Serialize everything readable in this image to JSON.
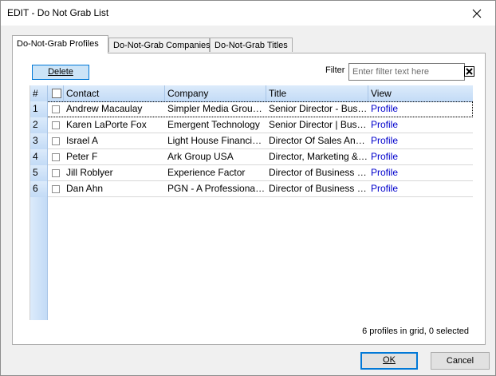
{
  "window": {
    "title": "EDIT - Do Not Grab List"
  },
  "tabs": [
    {
      "label": "Do-Not-Grab Profiles",
      "active": true
    },
    {
      "label": "Do-Not-Grab Companies",
      "active": false
    },
    {
      "label": "Do-Not-Grab Titles",
      "active": false
    }
  ],
  "toolbar": {
    "delete_label": "Delete",
    "filter_label": "Filter",
    "filter_value": "",
    "filter_placeholder": "Enter filter text here"
  },
  "grid": {
    "headers": {
      "num": "#",
      "contact": "Contact",
      "company": "Company",
      "title": "Title",
      "view": "View"
    },
    "rows": [
      {
        "num": "1",
        "contact": "Andrew Macaulay",
        "company": "Simpler Media Group, Inc.",
        "title": "Senior Director - Business Development",
        "view": "Profile"
      },
      {
        "num": "2",
        "contact": "Karen LaPorte Fox",
        "company": "Emergent Technology",
        "title": "Senior Director | Business Development",
        "view": "Profile"
      },
      {
        "num": "3",
        "contact": "Israel A",
        "company": "Light House Financial Group",
        "title": "Director Of Sales And Marketing",
        "view": "Profile"
      },
      {
        "num": "4",
        "contact": "Peter F",
        "company": "Ark Group USA",
        "title": "Director, Marketing & Sales",
        "view": "Profile"
      },
      {
        "num": "5",
        "contact": "Jill Roblyer",
        "company": "Experience Factor",
        "title": "Director of Business Development",
        "view": "Profile"
      },
      {
        "num": "6",
        "contact": "Dan Ahn",
        "company": "PGN - A Professional Network",
        "title": "Director of Business Development",
        "view": "Profile"
      }
    ]
  },
  "status": "6 profiles in grid, 0 selected",
  "footer": {
    "ok_label": "OK",
    "cancel_label": "Cancel"
  },
  "icons": {
    "close": "close-icon",
    "filter_clear": "clear-filter-icon",
    "checkbox": "checkbox-icon"
  },
  "colors": {
    "link": "#0000cc",
    "header": "#c3dbf6",
    "focus": "#0078d7"
  }
}
